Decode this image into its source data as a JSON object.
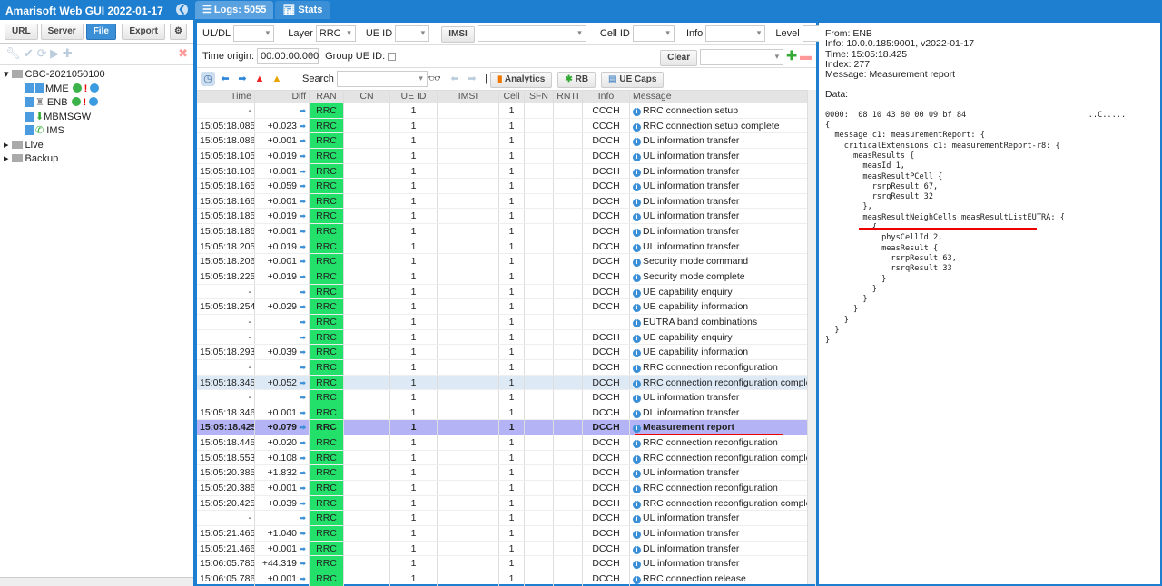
{
  "app": {
    "title": "Amarisoft Web GUI 2022-01-17",
    "buttons": [
      "URL",
      "Server",
      "File",
      "Export"
    ]
  },
  "tree": {
    "root": "CBC-2021050100",
    "nodes": [
      "MME",
      "ENB",
      "MBMSGW",
      "IMS"
    ],
    "others": [
      "Live",
      "Backup"
    ]
  },
  "tabs": [
    "Logs: 5055",
    "Stats"
  ],
  "filters": {
    "uldl_label": "UL/DL",
    "layer_label": "Layer",
    "layer_value": "RRC",
    "ueid_label": "UE ID",
    "imsi_button": "IMSI",
    "cellid_label": "Cell ID",
    "info_label": "Info",
    "level_label": "Level",
    "time_origin_label": "Time origin:",
    "time_origin_value": "00:00:00.000",
    "group_label": "Group UE ID:",
    "clear": "Clear"
  },
  "toolbar": {
    "search_label": "Search",
    "analytics": "Analytics",
    "rb": "RB",
    "uecaps": "UE Caps"
  },
  "columns": [
    "Time",
    "Diff",
    "RAN",
    "CN",
    "UE ID",
    "IMSI",
    "Cell",
    "SFN",
    "RNTI",
    "Info",
    "Message"
  ],
  "rows": [
    [
      "-",
      "",
      "RRC",
      "1",
      "1",
      "CCCH",
      "RRC connection setup"
    ],
    [
      "15:05:18.085",
      "+0.023",
      "RRC",
      "1",
      "1",
      "CCCH",
      "RRC connection setup complete"
    ],
    [
      "15:05:18.086",
      "+0.001",
      "RRC",
      "1",
      "1",
      "DCCH",
      "DL information transfer"
    ],
    [
      "15:05:18.105",
      "+0.019",
      "RRC",
      "1",
      "1",
      "DCCH",
      "UL information transfer"
    ],
    [
      "15:05:18.106",
      "+0.001",
      "RRC",
      "1",
      "1",
      "DCCH",
      "DL information transfer"
    ],
    [
      "15:05:18.165",
      "+0.059",
      "RRC",
      "1",
      "1",
      "DCCH",
      "UL information transfer"
    ],
    [
      "15:05:18.166",
      "+0.001",
      "RRC",
      "1",
      "1",
      "DCCH",
      "DL information transfer"
    ],
    [
      "15:05:18.185",
      "+0.019",
      "RRC",
      "1",
      "1",
      "DCCH",
      "UL information transfer"
    ],
    [
      "15:05:18.186",
      "+0.001",
      "RRC",
      "1",
      "1",
      "DCCH",
      "DL information transfer"
    ],
    [
      "15:05:18.205",
      "+0.019",
      "RRC",
      "1",
      "1",
      "DCCH",
      "UL information transfer"
    ],
    [
      "15:05:18.206",
      "+0.001",
      "RRC",
      "1",
      "1",
      "DCCH",
      "Security mode command"
    ],
    [
      "15:05:18.225",
      "+0.019",
      "RRC",
      "1",
      "1",
      "DCCH",
      "Security mode complete"
    ],
    [
      "-",
      "",
      "RRC",
      "1",
      "1",
      "DCCH",
      "UE capability enquiry"
    ],
    [
      "15:05:18.254",
      "+0.029",
      "RRC",
      "1",
      "1",
      "DCCH",
      "UE capability information"
    ],
    [
      "-",
      "",
      "RRC",
      "1",
      "1",
      "",
      "EUTRA band combinations"
    ],
    [
      "-",
      "",
      "RRC",
      "1",
      "1",
      "DCCH",
      "UE capability enquiry"
    ],
    [
      "15:05:18.293",
      "+0.039",
      "RRC",
      "1",
      "1",
      "DCCH",
      "UE capability information"
    ],
    [
      "-",
      "",
      "RRC",
      "1",
      "1",
      "DCCH",
      "RRC connection reconfiguration"
    ],
    [
      "15:05:18.345",
      "+0.052",
      "RRC",
      "1",
      "1",
      "DCCH",
      "RRC connection reconfiguration complete"
    ],
    [
      "-",
      "",
      "RRC",
      "1",
      "1",
      "DCCH",
      "UL information transfer"
    ],
    [
      "15:05:18.346",
      "+0.001",
      "RRC",
      "1",
      "1",
      "DCCH",
      "DL information transfer"
    ],
    [
      "15:05:18.425",
      "+0.079",
      "RRC",
      "1",
      "1",
      "DCCH",
      "Measurement report"
    ],
    [
      "15:05:18.445",
      "+0.020",
      "RRC",
      "1",
      "1",
      "DCCH",
      "RRC connection reconfiguration"
    ],
    [
      "15:05:18.553",
      "+0.108",
      "RRC",
      "1",
      "1",
      "DCCH",
      "RRC connection reconfiguration complete"
    ],
    [
      "15:05:20.385",
      "+1.832",
      "RRC",
      "1",
      "1",
      "DCCH",
      "UL information transfer"
    ],
    [
      "15:05:20.386",
      "+0.001",
      "RRC",
      "1",
      "1",
      "DCCH",
      "RRC connection reconfiguration"
    ],
    [
      "15:05:20.425",
      "+0.039",
      "RRC",
      "1",
      "1",
      "DCCH",
      "RRC connection reconfiguration complete"
    ],
    [
      "-",
      "",
      "RRC",
      "1",
      "1",
      "DCCH",
      "UL information transfer"
    ],
    [
      "15:05:21.465",
      "+1.040",
      "RRC",
      "1",
      "1",
      "DCCH",
      "UL information transfer"
    ],
    [
      "15:05:21.466",
      "+0.001",
      "RRC",
      "1",
      "1",
      "DCCH",
      "DL information transfer"
    ],
    [
      "15:06:05.785",
      "+44.319",
      "RRC",
      "1",
      "1",
      "DCCH",
      "UL information transfer"
    ],
    [
      "15:06:05.786",
      "+0.001",
      "RRC",
      "1",
      "1",
      "DCCH",
      "RRC connection release"
    ]
  ],
  "selected_row": 21,
  "highlighted_row": 18,
  "detail": {
    "from": "From: ENB",
    "info": "Info: 10.0.0.185:9001, v2022-01-17",
    "time": "Time: 15:05:18.425",
    "index": "Index: 277",
    "message": "Message: Measurement report",
    "data_label": "Data:",
    "dump": "0000:  08 10 43 80 00 09 bf 84                          ..C.....\n{\n  message c1: measurementReport: {\n    criticalExtensions c1: measurementReport-r8: {\n      measResults {\n        measId 1,\n        measResultPCell {\n          rsrpResult 67,\n          rsrqResult 32\n        },\n        measResultNeighCells measResultListEUTRA: {\n          {\n            physCellId 2,\n            measResult {\n              rsrpResult 63,\n              rsrqResult 33\n            }\n          }\n        }\n      }\n    }\n  }\n}"
  },
  "colors": {
    "accent": "#1e7fd0",
    "ran_cell": "#22e06a",
    "selected": "#b3b3f5",
    "annotation": "#e00000"
  }
}
